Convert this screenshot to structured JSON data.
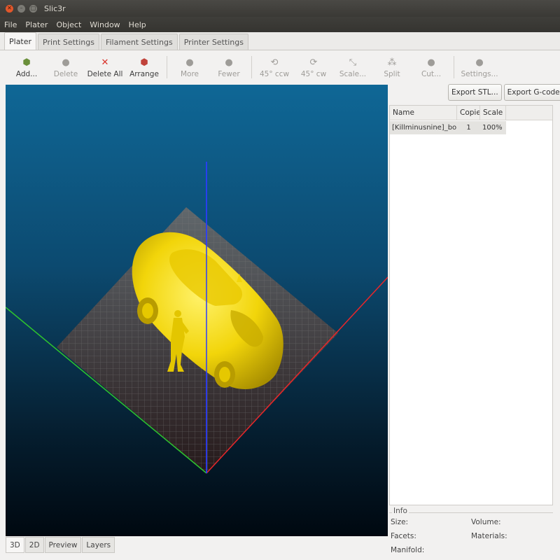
{
  "window": {
    "title": "Slic3r"
  },
  "menu": [
    "File",
    "Plater",
    "Object",
    "Window",
    "Help"
  ],
  "tabs": [
    "Plater",
    "Print Settings",
    "Filament Settings",
    "Printer Settings"
  ],
  "toolbar": [
    {
      "label": "Add...",
      "icon": "add-icon",
      "enabled": true
    },
    {
      "label": "Delete",
      "icon": "delete-icon",
      "enabled": false
    },
    {
      "label": "Delete All",
      "icon": "delete-all-icon",
      "enabled": true
    },
    {
      "label": "Arrange",
      "icon": "arrange-icon",
      "enabled": true
    },
    {
      "label": "More",
      "icon": "more-icon",
      "enabled": false
    },
    {
      "label": "Fewer",
      "icon": "fewer-icon",
      "enabled": false
    },
    {
      "label": "45° ccw",
      "icon": "rotate-ccw-icon",
      "enabled": false
    },
    {
      "label": "45° cw",
      "icon": "rotate-cw-icon",
      "enabled": false
    },
    {
      "label": "Scale...",
      "icon": "scale-icon",
      "enabled": false
    },
    {
      "label": "Split",
      "icon": "split-icon",
      "enabled": false
    },
    {
      "label": "Cut...",
      "icon": "cut-icon",
      "enabled": false
    },
    {
      "label": "Settings...",
      "icon": "settings-icon",
      "enabled": false
    }
  ],
  "side": {
    "export_stl": "Export STL...",
    "export_gcode": "Export G-code..."
  },
  "object_list": {
    "columns": [
      "Name",
      "Copies",
      "Scale"
    ],
    "rows": [
      {
        "name": "[Killminusnine]_bo...",
        "copies": "1",
        "scale": "100%"
      }
    ]
  },
  "info": {
    "title": "Info",
    "size": "Size:",
    "volume": "Volume:",
    "facets": "Facets:",
    "materials": "Materials:",
    "manifold": "Manifold:"
  },
  "view_tabs": [
    "3D",
    "2D",
    "Preview",
    "Layers"
  ],
  "colors": {
    "model": "#f2d50a",
    "axis_x": "#e8262a",
    "axis_y": "#2ec42e",
    "axis_z": "#2a3cff",
    "bed": "#5a5a5a"
  }
}
